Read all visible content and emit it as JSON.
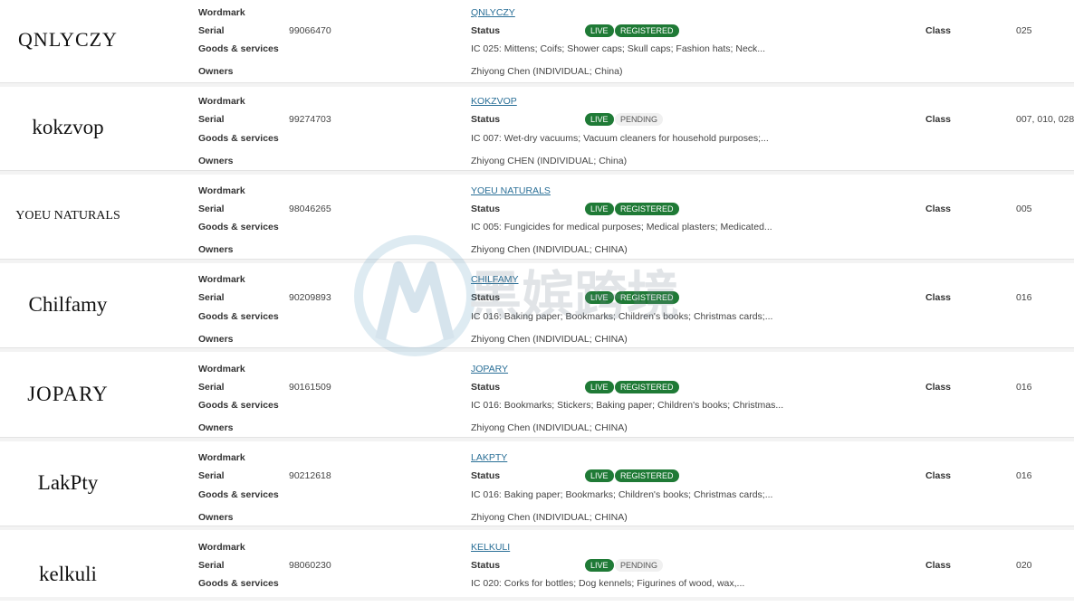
{
  "labels": {
    "wordmark": "Wordmark",
    "serial": "Serial",
    "goods": "Goods & services",
    "owners": "Owners",
    "status": "Status",
    "class": "Class"
  },
  "records": [
    {
      "image_text": "QNLYCZY",
      "wordmark": "QNLYCZY",
      "serial": "99066470",
      "live": "LIVE",
      "status": "REGISTERED",
      "goods": "IC 025: Mittens; Coifs; Shower caps; Skull caps; Fashion hats; Neck...",
      "owner": "Zhiyong Chen (INDIVIDUAL; China)",
      "class": "025"
    },
    {
      "image_text": "kokzvop",
      "wordmark": "KOKZVOP",
      "serial": "99274703",
      "live": "LIVE",
      "status": "PENDING",
      "goods": "IC 007: Wet-dry vacuums; Vacuum cleaners for household purposes;...",
      "owner": "Zhiyong CHEN (INDIVIDUAL; China)",
      "class": "007, 010, 028"
    },
    {
      "image_text": "YOEU NATURALS",
      "wordmark": "YOEU NATURALS",
      "serial": "98046265",
      "live": "LIVE",
      "status": "REGISTERED",
      "goods": "IC 005: Fungicides for medical purposes; Medical plasters; Medicated...",
      "owner": "Zhiyong Chen (INDIVIDUAL; CHINA)",
      "class": "005"
    },
    {
      "image_text": "Chilfamy",
      "wordmark": "CHILFAMY",
      "serial": "90209893",
      "live": "LIVE",
      "status": "REGISTERED",
      "goods": "IC 016: Baking paper; Bookmarks; Children's books; Christmas cards;...",
      "owner": "Zhiyong Chen (INDIVIDUAL; CHINA)",
      "class": "016"
    },
    {
      "image_text": "JOPARY",
      "wordmark": "JOPARY",
      "serial": "90161509",
      "live": "LIVE",
      "status": "REGISTERED",
      "goods": "IC 016: Bookmarks; Stickers; Baking paper; Children's books; Christmas...",
      "owner": "Zhiyong Chen (INDIVIDUAL; CHINA)",
      "class": "016"
    },
    {
      "image_text": "LakPty",
      "wordmark": "LAKPTY",
      "serial": "90212618",
      "live": "LIVE",
      "status": "REGISTERED",
      "goods": "IC 016: Baking paper; Bookmarks; Children's books; Christmas cards;...",
      "owner": "Zhiyong Chen (INDIVIDUAL; CHINA)",
      "class": "016"
    },
    {
      "image_text": "kelkuli",
      "wordmark": "KELKULI",
      "serial": "98060230",
      "live": "LIVE",
      "status": "PENDING",
      "goods": "IC 020: Corks for bottles; Dog kennels; Figurines of wood, wax,...",
      "owner": "",
      "class": "020"
    }
  ],
  "watermark_text": "黑嫔跨境"
}
